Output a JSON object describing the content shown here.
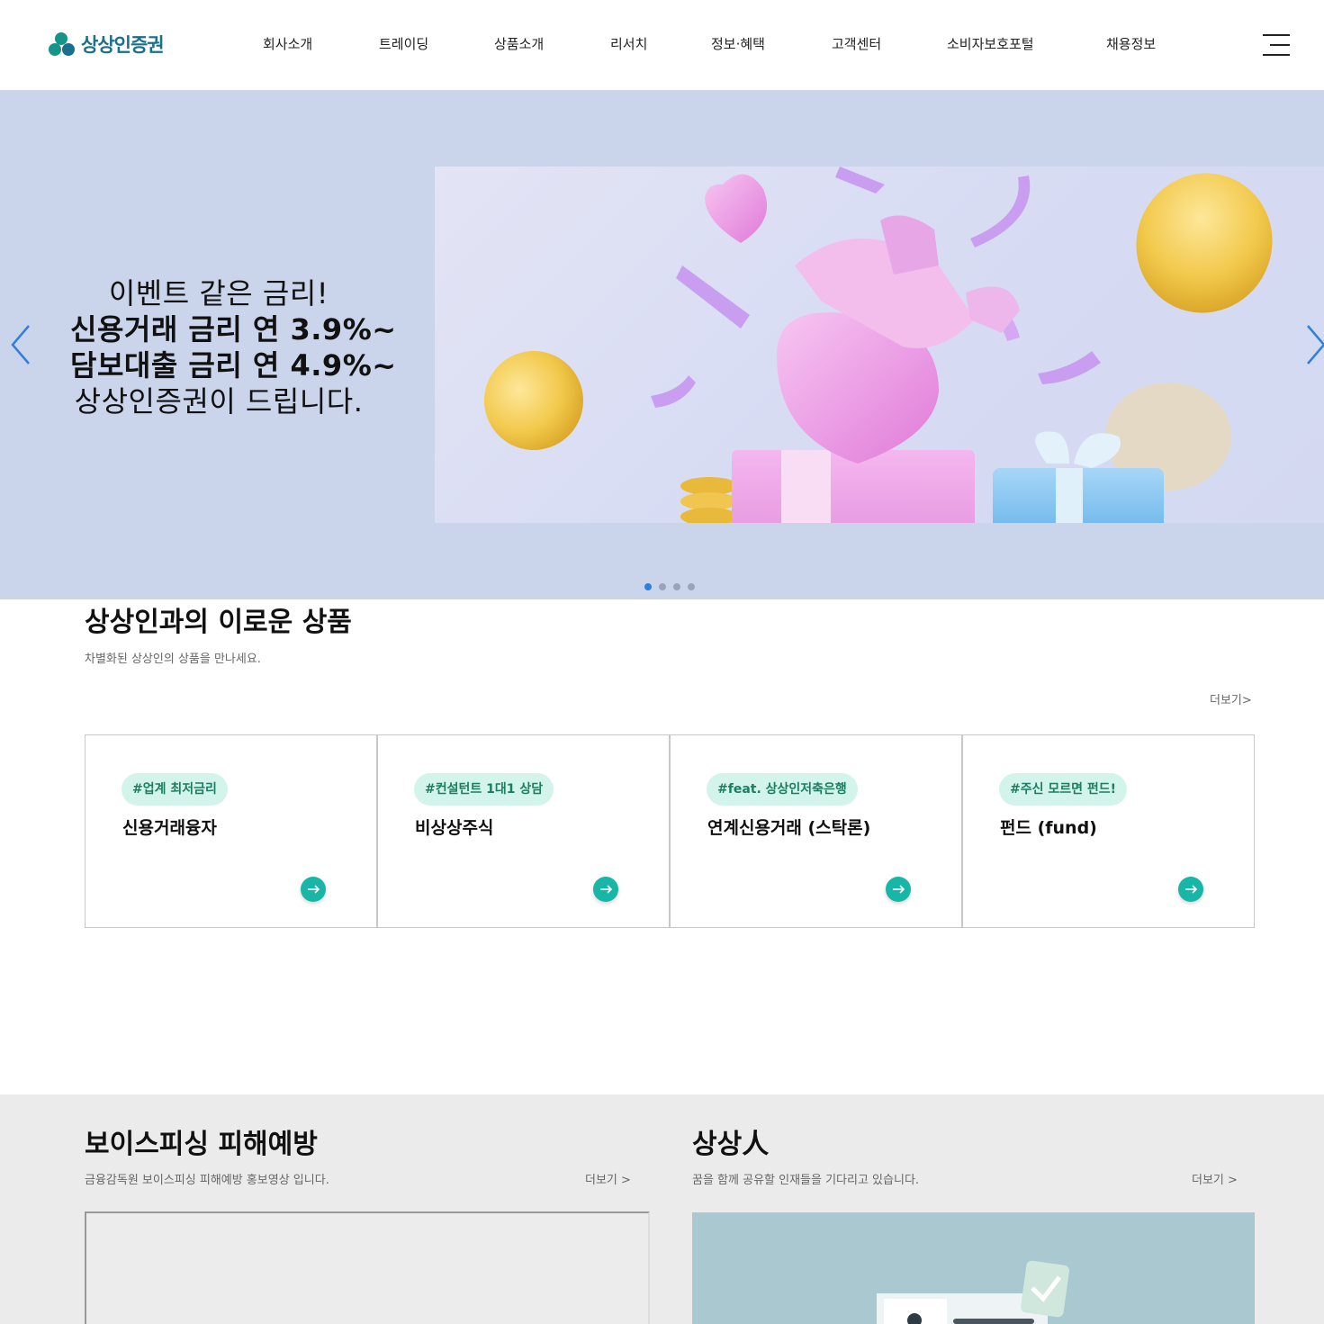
{
  "header": {
    "logo_text": "상상인증권",
    "nav": [
      "회사소개",
      "트레이딩",
      "상품소개",
      "리서치",
      "정보·혜택",
      "고객센터",
      "소비자보호포털",
      "채용정보"
    ]
  },
  "hero": {
    "line1": "이벤트 같은 금리!",
    "line2": "신용거래 금리 연 3.9%~",
    "line3": "담보대출 금리 연 4.9%~",
    "line4": "상상인증권이 드립니다.",
    "slide_count": 4,
    "active_slide": 1
  },
  "products": {
    "title": "상상인과의 이로운 상품",
    "subtitle": "차별화된 상상인의 상품을 만나세요.",
    "more": "더보기>",
    "cards": [
      {
        "tag": "#업계 최저금리",
        "title": "신용거래융자"
      },
      {
        "tag": "#컨설턴트 1대1 상담",
        "title": "비상상주식"
      },
      {
        "tag": "#feat. 상상인저축은행",
        "title": "연계신용거래 (스탁론)"
      },
      {
        "tag": "#주신 모르면 펀드!",
        "title": "펀드 (fund)"
      }
    ]
  },
  "voice": {
    "title": "보이스피싱 피해예방",
    "subtitle": "금융감독원 보이스피싱 피해예방 홍보영상 입니다.",
    "more": "더보기 >"
  },
  "people": {
    "title": "상상人",
    "subtitle": "꿈을 함께 공유할 인재들을 기다리고 있습니다.",
    "more": "더보기 >"
  },
  "colors": {
    "hero_bg": "#cad4ea",
    "accent": "#17b6a6",
    "tag_bg": "#d2f4ea",
    "tag_text": "#1c7d62",
    "bottom_bg": "#ebebeb"
  }
}
